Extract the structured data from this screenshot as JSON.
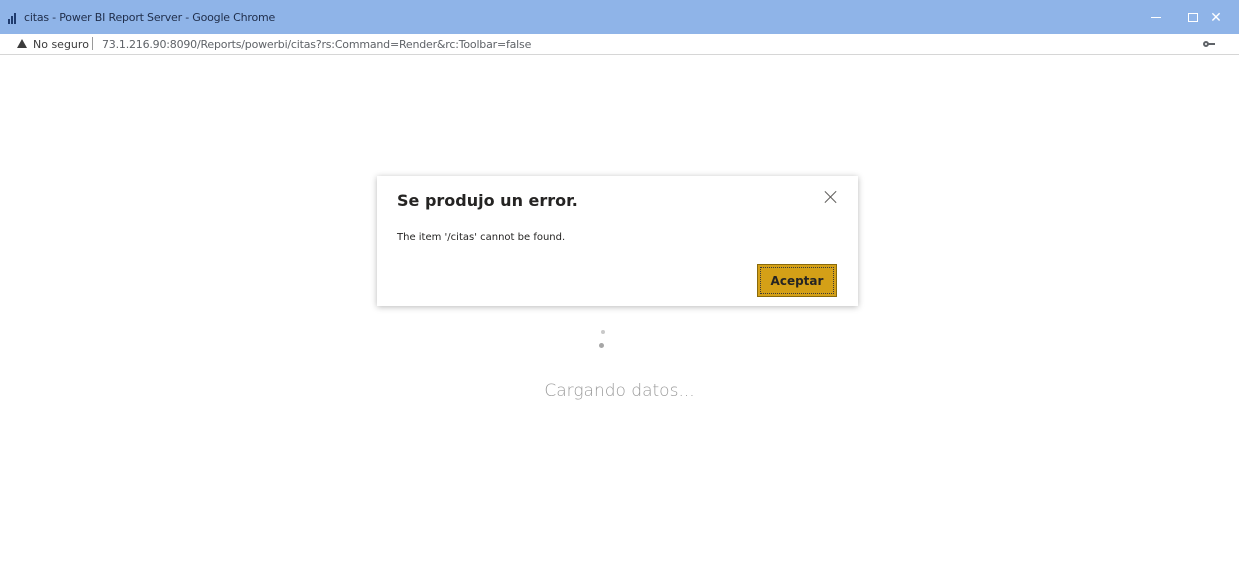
{
  "window": {
    "title": "citas - Power BI Report Server - Google Chrome",
    "minimize_icon": "minimize-icon",
    "maximize_icon": "maximize-icon",
    "close_icon": "close-icon"
  },
  "addressbar": {
    "security_label": "No seguro",
    "url": "73.1.216.90:8090/Reports/powerbi/citas?rs:Command=Render&rc:Toolbar=false",
    "warning_icon": "warning-triangle-icon",
    "key_icon": "key-icon"
  },
  "dialog": {
    "title": "Se produjo un error.",
    "message": "The item '/citas' cannot be found.",
    "button_label": "Aceptar",
    "button_color": "#d4a017"
  },
  "loading": {
    "text": "Cargando datos..."
  }
}
